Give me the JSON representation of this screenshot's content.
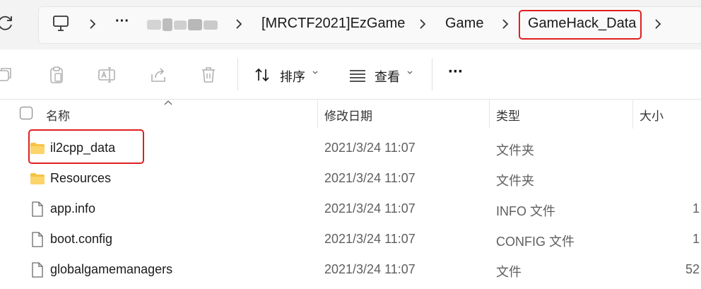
{
  "address_bar": {
    "overflow": "···",
    "crumbs": [
      "[MRCTF2021]EzGame",
      "Game",
      "GameHack_Data"
    ]
  },
  "toolbar": {
    "sort_label": "排序",
    "view_label": "查看",
    "more": "···"
  },
  "columns": {
    "name": "名称",
    "date": "修改日期",
    "type": "类型",
    "size": "大小"
  },
  "files": [
    {
      "name": "il2cpp_data",
      "date": "2021/3/24 11:07",
      "type": "文件夹",
      "size": "",
      "icon": "folder-icon"
    },
    {
      "name": "Resources",
      "date": "2021/3/24 11:07",
      "type": "文件夹",
      "size": "",
      "icon": "folder-icon"
    },
    {
      "name": "app.info",
      "date": "2021/3/24 11:07",
      "type": "INFO 文件",
      "size": "1",
      "icon": "file-icon"
    },
    {
      "name": "boot.config",
      "date": "2021/3/24 11:07",
      "type": "CONFIG 文件",
      "size": "1",
      "icon": "file-icon"
    },
    {
      "name": "globalgamemanagers",
      "date": "2021/3/24 11:07",
      "type": "文件",
      "size": "52",
      "icon": "file-icon"
    }
  ],
  "colors": {
    "highlight": "#e01f1f",
    "folder": "#f6c343"
  }
}
